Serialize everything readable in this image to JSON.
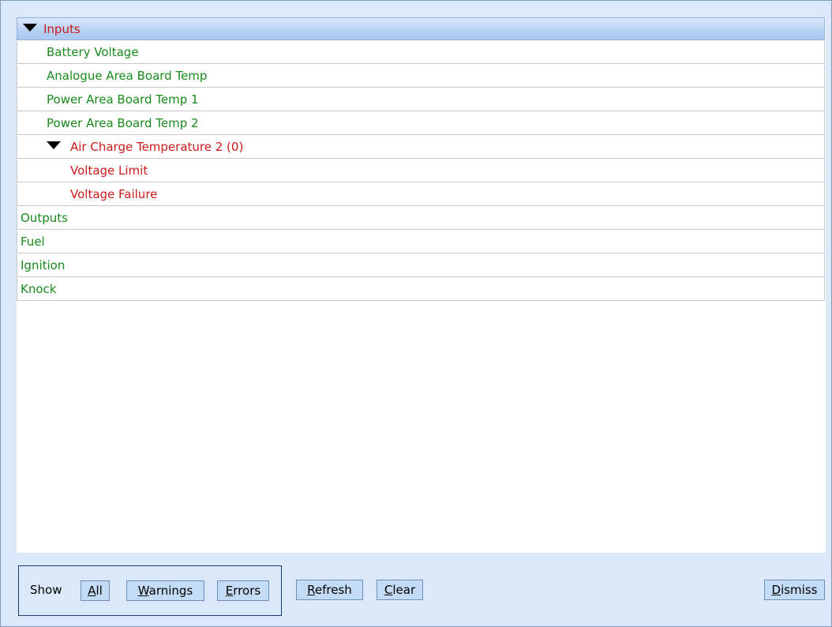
{
  "tree": {
    "rows": [
      {
        "label": "Inputs",
        "depth": 0,
        "expanded": true,
        "status": "error",
        "selected": true
      },
      {
        "label": "Battery Voltage",
        "depth": 1,
        "status": "ok"
      },
      {
        "label": "Analogue Area Board Temp",
        "depth": 1,
        "status": "ok"
      },
      {
        "label": "Power Area Board Temp 1",
        "depth": 1,
        "status": "ok"
      },
      {
        "label": "Power Area Board Temp 2",
        "depth": 1,
        "status": "ok"
      },
      {
        "label": "Air Charge Temperature 2 (0)",
        "depth": 1,
        "expanded": true,
        "status": "error"
      },
      {
        "label": "Voltage Limit",
        "depth": 2,
        "status": "error"
      },
      {
        "label": "Voltage Failure",
        "depth": 2,
        "status": "error"
      },
      {
        "label": "Outputs",
        "depth": 0,
        "status": "ok"
      },
      {
        "label": "Fuel",
        "depth": 0,
        "status": "ok"
      },
      {
        "label": "Ignition",
        "depth": 0,
        "status": "ok"
      },
      {
        "label": "Knock",
        "depth": 0,
        "status": "ok"
      }
    ]
  },
  "footer": {
    "show_label": "Show",
    "all": {
      "mnemonic": "A",
      "rest": "ll"
    },
    "warnings": {
      "mnemonic": "W",
      "rest": "arnings"
    },
    "errors": {
      "mnemonic": "E",
      "rest": "rrors"
    },
    "refresh": {
      "mnemonic": "R",
      "rest": "efresh"
    },
    "clear": {
      "mnemonic": "C",
      "rest": "lear"
    },
    "dismiss": {
      "mnemonic": "D",
      "rest": "ismiss"
    }
  },
  "colors": {
    "ok": "#18891c",
    "error": "#cc1a1a",
    "background": "#dbe8f9",
    "button": "#c4dbf6"
  }
}
